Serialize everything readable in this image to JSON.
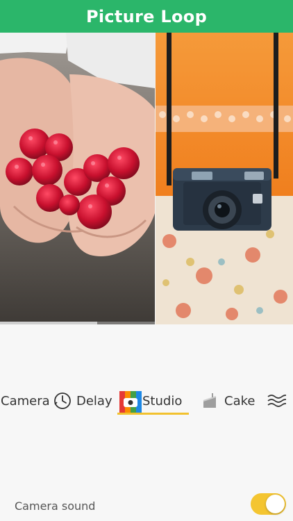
{
  "header": {
    "title": "Picture Loop"
  },
  "colors": {
    "brand": "#2bb66a",
    "accent": "#f2c12e",
    "toggle_on": "#f4c531"
  },
  "preview": {
    "left_photo": "raspberries-in-hands",
    "right_photo": "vintage-camera-on-strap",
    "progress": 0.63
  },
  "modes": {
    "items": [
      {
        "label": "Camera",
        "icon": "camera-icon"
      },
      {
        "label": "Delay",
        "icon": "timer-icon"
      },
      {
        "label": "Studio",
        "icon": "studio-icon",
        "selected": true
      },
      {
        "label": "Cake",
        "icon": "cake-icon"
      },
      {
        "label": "",
        "icon": "wave-icon"
      }
    ]
  },
  "settings": {
    "camera_sound_label": "Camera sound",
    "camera_sound_on": true
  }
}
